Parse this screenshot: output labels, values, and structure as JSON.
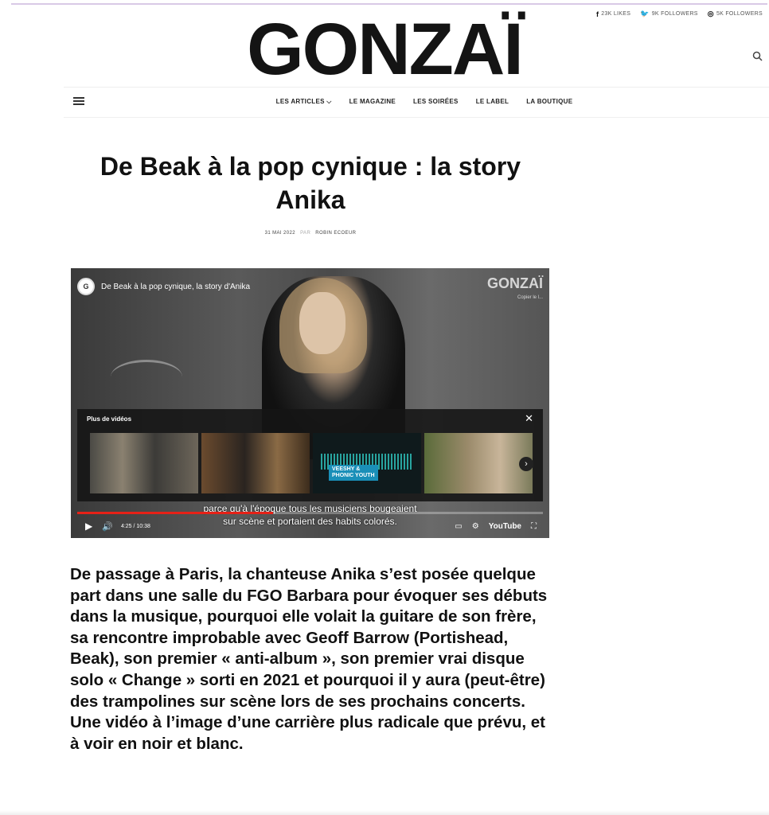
{
  "social": [
    {
      "icon": "f",
      "icon_name": "facebook-icon",
      "label": "23K LIKES"
    },
    {
      "icon": "🐦",
      "icon_name": "twitter-icon",
      "label": "9K FOLLOWERS"
    },
    {
      "icon": "◎",
      "icon_name": "instagram-icon",
      "label": "5K FOLLOWERS"
    }
  ],
  "site": {
    "logo": "GONZAÏ"
  },
  "nav": {
    "items": [
      "LES ARTICLES ⌵",
      "LE MAGAZINE",
      "LES SOIRÉES",
      "LE LABEL",
      "LA BOUTIQUE"
    ]
  },
  "article": {
    "title": "De Beak à la pop cynique : la story Anika",
    "date": "31 MAI 2022",
    "by": "PAR",
    "author": "ROBIN ECOEUR",
    "lead": "De passage à Paris, la chanteuse Anika s’est posée quelque part dans une salle du FGO Barbara pour évoquer ses débuts dans la musique, pourquoi elle volait la guitare de son frère, sa rencontre improbable avec Geoff Barrow (Portishead, Beak), son premier « anti-album », son premier vrai disque solo « Change » sorti en 2021 et pourquoi il y aura (peut-être) des trampolines sur scène lors de ses prochains concerts. Une vidéo à l’image d’une carrière plus radicale que prévu, et à voir en noir et blanc."
  },
  "video": {
    "title": "De Beak à la pop cynique, la story d'Anika",
    "channel_badge": "G",
    "brand": "GONZAÏ",
    "brand_sub": "Copier le l...",
    "more_title": "Plus de vidéos",
    "thumb3_line1": "VEESHY &",
    "thumb3_line2": "PHONIC YOUTH",
    "subtitle_line1": "parce qu'à l'époque tous les musiciens bougeaient",
    "subtitle_line2": "sur scène et portaient des habits colorés.",
    "time": "4:25 / 10:38",
    "progress_fraction": 0.42,
    "youtube_label": "YouTube"
  }
}
